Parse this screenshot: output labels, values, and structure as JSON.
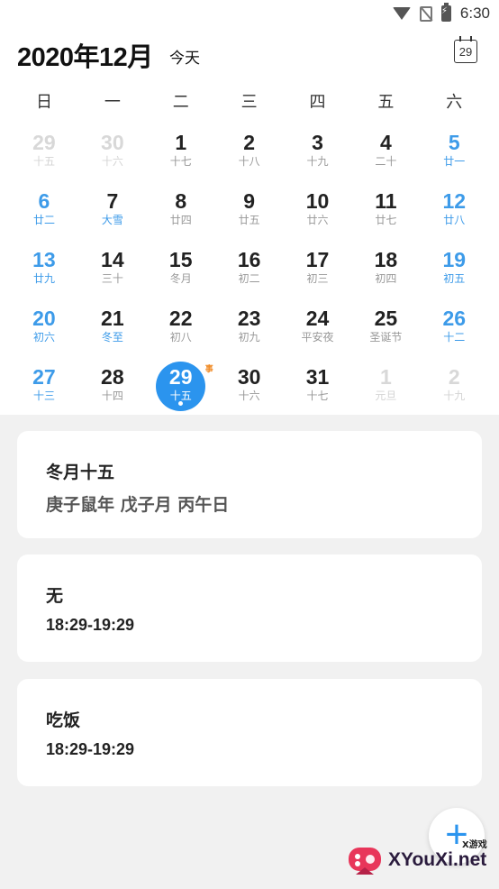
{
  "status_bar": {
    "time": "6:30"
  },
  "header": {
    "month_title": "2020年12月",
    "today_label": "今天",
    "calendar_icon_day": "29"
  },
  "weekdays": [
    "日",
    "一",
    "二",
    "三",
    "四",
    "五",
    "六"
  ],
  "calendar": {
    "weeks": [
      [
        {
          "day": "29",
          "lunar": "十五",
          "type": "dim"
        },
        {
          "day": "30",
          "lunar": "十六",
          "type": "dim"
        },
        {
          "day": "1",
          "lunar": "十七",
          "type": "normal"
        },
        {
          "day": "2",
          "lunar": "十八",
          "type": "normal"
        },
        {
          "day": "3",
          "lunar": "十九",
          "type": "normal"
        },
        {
          "day": "4",
          "lunar": "二十",
          "type": "normal"
        },
        {
          "day": "5",
          "lunar": "廿一",
          "type": "weekend"
        }
      ],
      [
        {
          "day": "6",
          "lunar": "廿二",
          "type": "weekend"
        },
        {
          "day": "7",
          "lunar": "大雪",
          "type": "festival"
        },
        {
          "day": "8",
          "lunar": "廿四",
          "type": "normal"
        },
        {
          "day": "9",
          "lunar": "廿五",
          "type": "normal"
        },
        {
          "day": "10",
          "lunar": "廿六",
          "type": "normal"
        },
        {
          "day": "11",
          "lunar": "廿七",
          "type": "normal"
        },
        {
          "day": "12",
          "lunar": "廿八",
          "type": "weekend"
        }
      ],
      [
        {
          "day": "13",
          "lunar": "廿九",
          "type": "weekend"
        },
        {
          "day": "14",
          "lunar": "三十",
          "type": "normal"
        },
        {
          "day": "15",
          "lunar": "冬月",
          "type": "normal"
        },
        {
          "day": "16",
          "lunar": "初二",
          "type": "normal"
        },
        {
          "day": "17",
          "lunar": "初三",
          "type": "normal"
        },
        {
          "day": "18",
          "lunar": "初四",
          "type": "normal"
        },
        {
          "day": "19",
          "lunar": "初五",
          "type": "weekend"
        }
      ],
      [
        {
          "day": "20",
          "lunar": "初六",
          "type": "weekend"
        },
        {
          "day": "21",
          "lunar": "冬至",
          "type": "festival"
        },
        {
          "day": "22",
          "lunar": "初八",
          "type": "normal"
        },
        {
          "day": "23",
          "lunar": "初九",
          "type": "normal"
        },
        {
          "day": "24",
          "lunar": "平安夜",
          "type": "normal"
        },
        {
          "day": "25",
          "lunar": "圣诞节",
          "type": "normal"
        },
        {
          "day": "26",
          "lunar": "十二",
          "type": "weekend"
        }
      ],
      [
        {
          "day": "27",
          "lunar": "十三",
          "type": "weekend"
        },
        {
          "day": "28",
          "lunar": "十四",
          "type": "normal"
        },
        {
          "day": "29",
          "lunar": "十五",
          "type": "selected",
          "tag": "事"
        },
        {
          "day": "30",
          "lunar": "十六",
          "type": "normal"
        },
        {
          "day": "31",
          "lunar": "十七",
          "type": "normal"
        },
        {
          "day": "1",
          "lunar": "元旦",
          "type": "dim"
        },
        {
          "day": "2",
          "lunar": "十九",
          "type": "dim"
        }
      ]
    ]
  },
  "lunar_card": {
    "title": "冬月十五",
    "subtitle": "庚子鼠年 戊子月 丙午日"
  },
  "events": [
    {
      "title": "无",
      "time": "18:29-19:29"
    },
    {
      "title": "吃饭",
      "time": "18:29-19:29"
    }
  ],
  "fab": {
    "label": "+"
  },
  "watermark": {
    "text": "XYouXi.net",
    "small": "X游戏"
  },
  "colors": {
    "accent": "#2b94ee",
    "weekend": "#3d9be9",
    "event_tag": "#f08a24"
  }
}
